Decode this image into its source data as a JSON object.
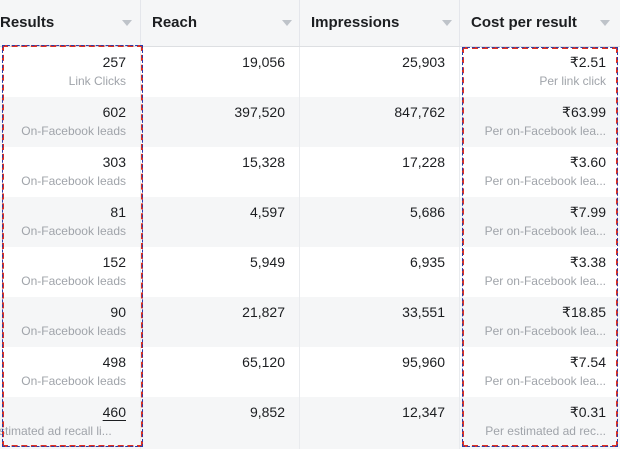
{
  "columns": [
    {
      "label": "Results"
    },
    {
      "label": "Reach"
    },
    {
      "label": "Impressions"
    },
    {
      "label": "Cost per result"
    }
  ],
  "rows": [
    {
      "results": "257",
      "results_sub": "Link Clicks",
      "reach": "19,056",
      "impressions": "25,903",
      "cost": "₹2.51",
      "cost_sub": "Per link click"
    },
    {
      "results": "602",
      "results_sub": "On-Facebook leads",
      "reach": "397,520",
      "impressions": "847,762",
      "cost": "₹63.99",
      "cost_sub": "Per on-Facebook lea..."
    },
    {
      "results": "303",
      "results_sub": "On-Facebook leads",
      "reach": "15,328",
      "impressions": "17,228",
      "cost": "₹3.60",
      "cost_sub": "Per on-Facebook lea..."
    },
    {
      "results": "81",
      "results_sub": "On-Facebook leads",
      "reach": "4,597",
      "impressions": "5,686",
      "cost": "₹7.99",
      "cost_sub": "Per on-Facebook lea..."
    },
    {
      "results": "152",
      "results_sub": "On-Facebook leads",
      "reach": "5,949",
      "impressions": "6,935",
      "cost": "₹3.38",
      "cost_sub": "Per on-Facebook lea..."
    },
    {
      "results": "90",
      "results_sub": "On-Facebook leads",
      "reach": "21,827",
      "impressions": "33,551",
      "cost": "₹18.85",
      "cost_sub": "Per on-Facebook lea..."
    },
    {
      "results": "498",
      "results_sub": "On-Facebook leads",
      "reach": "65,120",
      "impressions": "95,960",
      "cost": "₹7.54",
      "cost_sub": "Per on-Facebook lea..."
    },
    {
      "results": "460",
      "results_sub": "stimated ad recall li...",
      "reach": "9,852",
      "impressions": "12,347",
      "cost": "₹0.31",
      "cost_sub": "Per estimated ad rec..."
    }
  ],
  "colors": {
    "header_bg": "#f5f6f7",
    "alt_row_bg": "#f5f6f7",
    "selection_dash": "#d93025",
    "selection_dash_inner": "#2d3ca8"
  }
}
